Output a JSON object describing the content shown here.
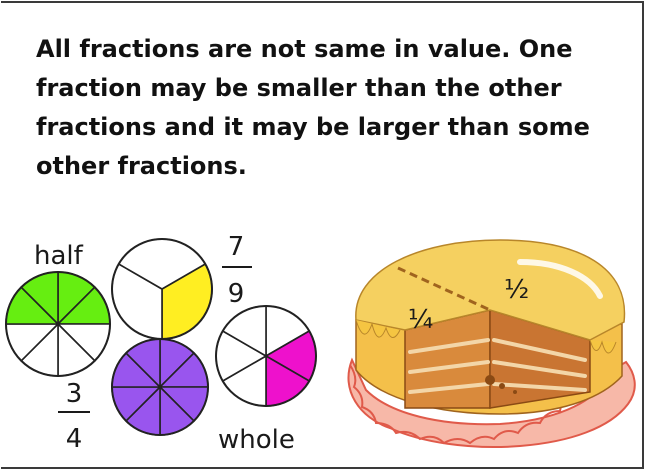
{
  "text": {
    "paragraph": "All fractions are not same in value. One fraction may be smaller than the other fractions and it may be larger than some other fractions."
  },
  "labels": {
    "half": "half",
    "seven_ninths_num": "7",
    "seven_ninths_den": "9",
    "three_quarters_num": "3",
    "three_quarters_den": "4",
    "whole": "whole",
    "cake_quarter": "¼",
    "cake_half": "½"
  },
  "circles": [
    {
      "name": "circle-half",
      "slices": 8,
      "shaded": [
        0,
        1,
        6,
        7
      ],
      "color": "#66ee11"
    },
    {
      "name": "circle-third",
      "slices": 3,
      "shaded": [
        0
      ],
      "color": "#ffee22"
    },
    {
      "name": "circle-whole",
      "slices": 8,
      "shaded": [
        0,
        1,
        2,
        3,
        4,
        5,
        6,
        7
      ],
      "color": "#9955ee"
    },
    {
      "name": "circle-sixth",
      "slices": 6,
      "shaded": [
        1,
        2
      ],
      "color": "#ee11cc"
    }
  ],
  "colors": {
    "green": "#66ee11",
    "yellow": "#ffee22",
    "purple": "#9955ee",
    "magenta": "#ee11cc",
    "cake_cream": "#f5c542",
    "cake_sponge": "#d98a3c",
    "plate": "#f7b8a8"
  }
}
